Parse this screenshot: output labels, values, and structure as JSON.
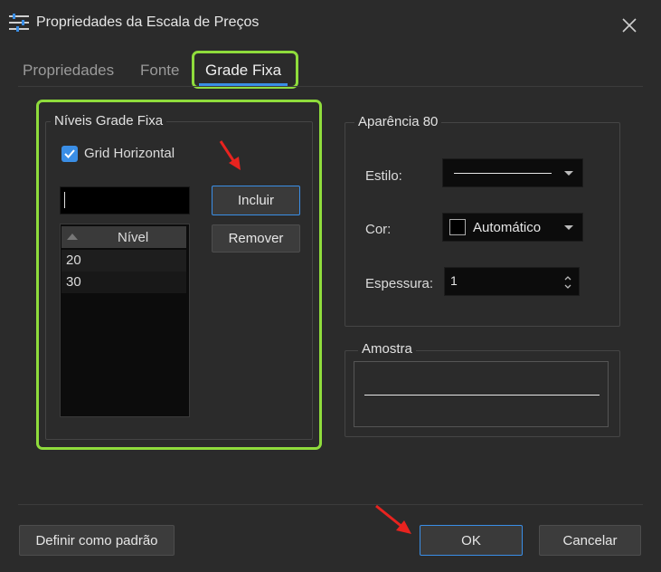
{
  "window": {
    "title": "Propriedades da Escala de Preços",
    "title_icon": "sliders-icon",
    "close_icon": "close-icon"
  },
  "tabs": [
    {
      "label": "Propriedades",
      "active": false
    },
    {
      "label": "Fonte",
      "active": false
    },
    {
      "label": "Grade Fixa",
      "active": true
    }
  ],
  "levels_group": {
    "title": "Níveis Grade Fixa",
    "grid_horizontal": {
      "label": "Grid Horizontal",
      "checked": true
    },
    "level_input": {
      "value": ""
    },
    "add_button": "Incluir",
    "remove_button": "Remover",
    "list": {
      "header": "Nível",
      "rows": [
        "20",
        "30"
      ]
    }
  },
  "appearance_group": {
    "title": "Aparência 80",
    "style_label": "Estilo:",
    "color_label": "Cor:",
    "color_value": "Automático",
    "color_swatch": "#000000",
    "thickness_label": "Espessura:",
    "thickness_value": "1"
  },
  "sample_group": {
    "title": "Amostra"
  },
  "footer": {
    "default_button": "Definir como padrão",
    "ok_button": "OK",
    "cancel_button": "Cancelar"
  },
  "colors": {
    "accent": "#3a8ee6",
    "highlight": "#8fdc3c",
    "annotation_arrow": "#e8231f"
  }
}
